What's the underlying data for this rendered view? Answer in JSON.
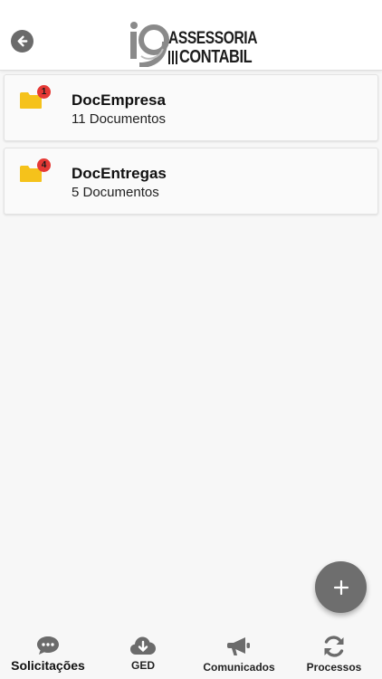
{
  "header": {
    "logo_line1": "ASSESSORIA",
    "logo_line2": "CONTABIL",
    "back_icon": "arrow-left-circle-icon"
  },
  "folders": [
    {
      "title": "DocEmpresa",
      "subtitle": "11 Documentos",
      "badge": "1",
      "icon": "folder-icon"
    },
    {
      "title": "DocEntregas",
      "subtitle": "5 Documentos",
      "badge": "4",
      "icon": "folder-icon"
    }
  ],
  "fab": {
    "label": "+",
    "icon": "plus-icon"
  },
  "tabs": [
    {
      "label": "Solicitações",
      "icon": "chat-bubble-icon",
      "active": true
    },
    {
      "label": "GED",
      "icon": "cloud-download-icon"
    },
    {
      "label": "Comunicados",
      "icon": "megaphone-icon"
    },
    {
      "label": "Processos",
      "icon": "refresh-icon"
    }
  ],
  "colors": {
    "folder": "#F5C21B",
    "badge": "#E53935",
    "icon_gray": "#6B6B6B",
    "background": "#F7F7F7"
  }
}
